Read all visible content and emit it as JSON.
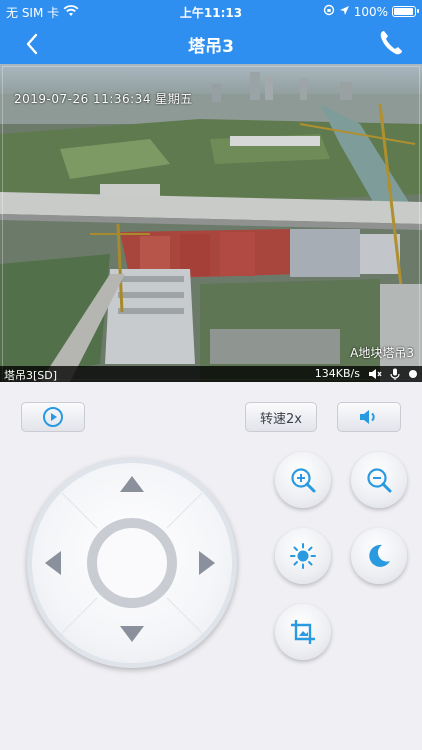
{
  "status_bar": {
    "carrier": "无 SIM 卡",
    "time": "上午11:13",
    "battery_text": "100%",
    "battery_level": 1.0
  },
  "nav": {
    "title": "塔吊3",
    "back_icon": "chevron-left-icon",
    "call_icon": "phone-icon"
  },
  "video": {
    "osd_timestamp": "2019-07-26 11:36:34 星期五",
    "osd_site": "A地块塔吊3",
    "camera_label": "塔吊3[SD]",
    "bitrate": "134KB/s"
  },
  "controls": {
    "play_icon": "play-icon",
    "speed_label": "转速2x",
    "volume_icon": "volume-icon",
    "zoom_in_icon": "zoom-in-icon",
    "zoom_out_icon": "zoom-out-icon",
    "brightness_icon": "sun-icon",
    "night_icon": "moon-icon",
    "crop_icon": "crop-icon"
  },
  "colors": {
    "primary": "#2f8ff0",
    "icon_blue": "#2a9ae0",
    "arrow_gray": "#8a919c"
  }
}
